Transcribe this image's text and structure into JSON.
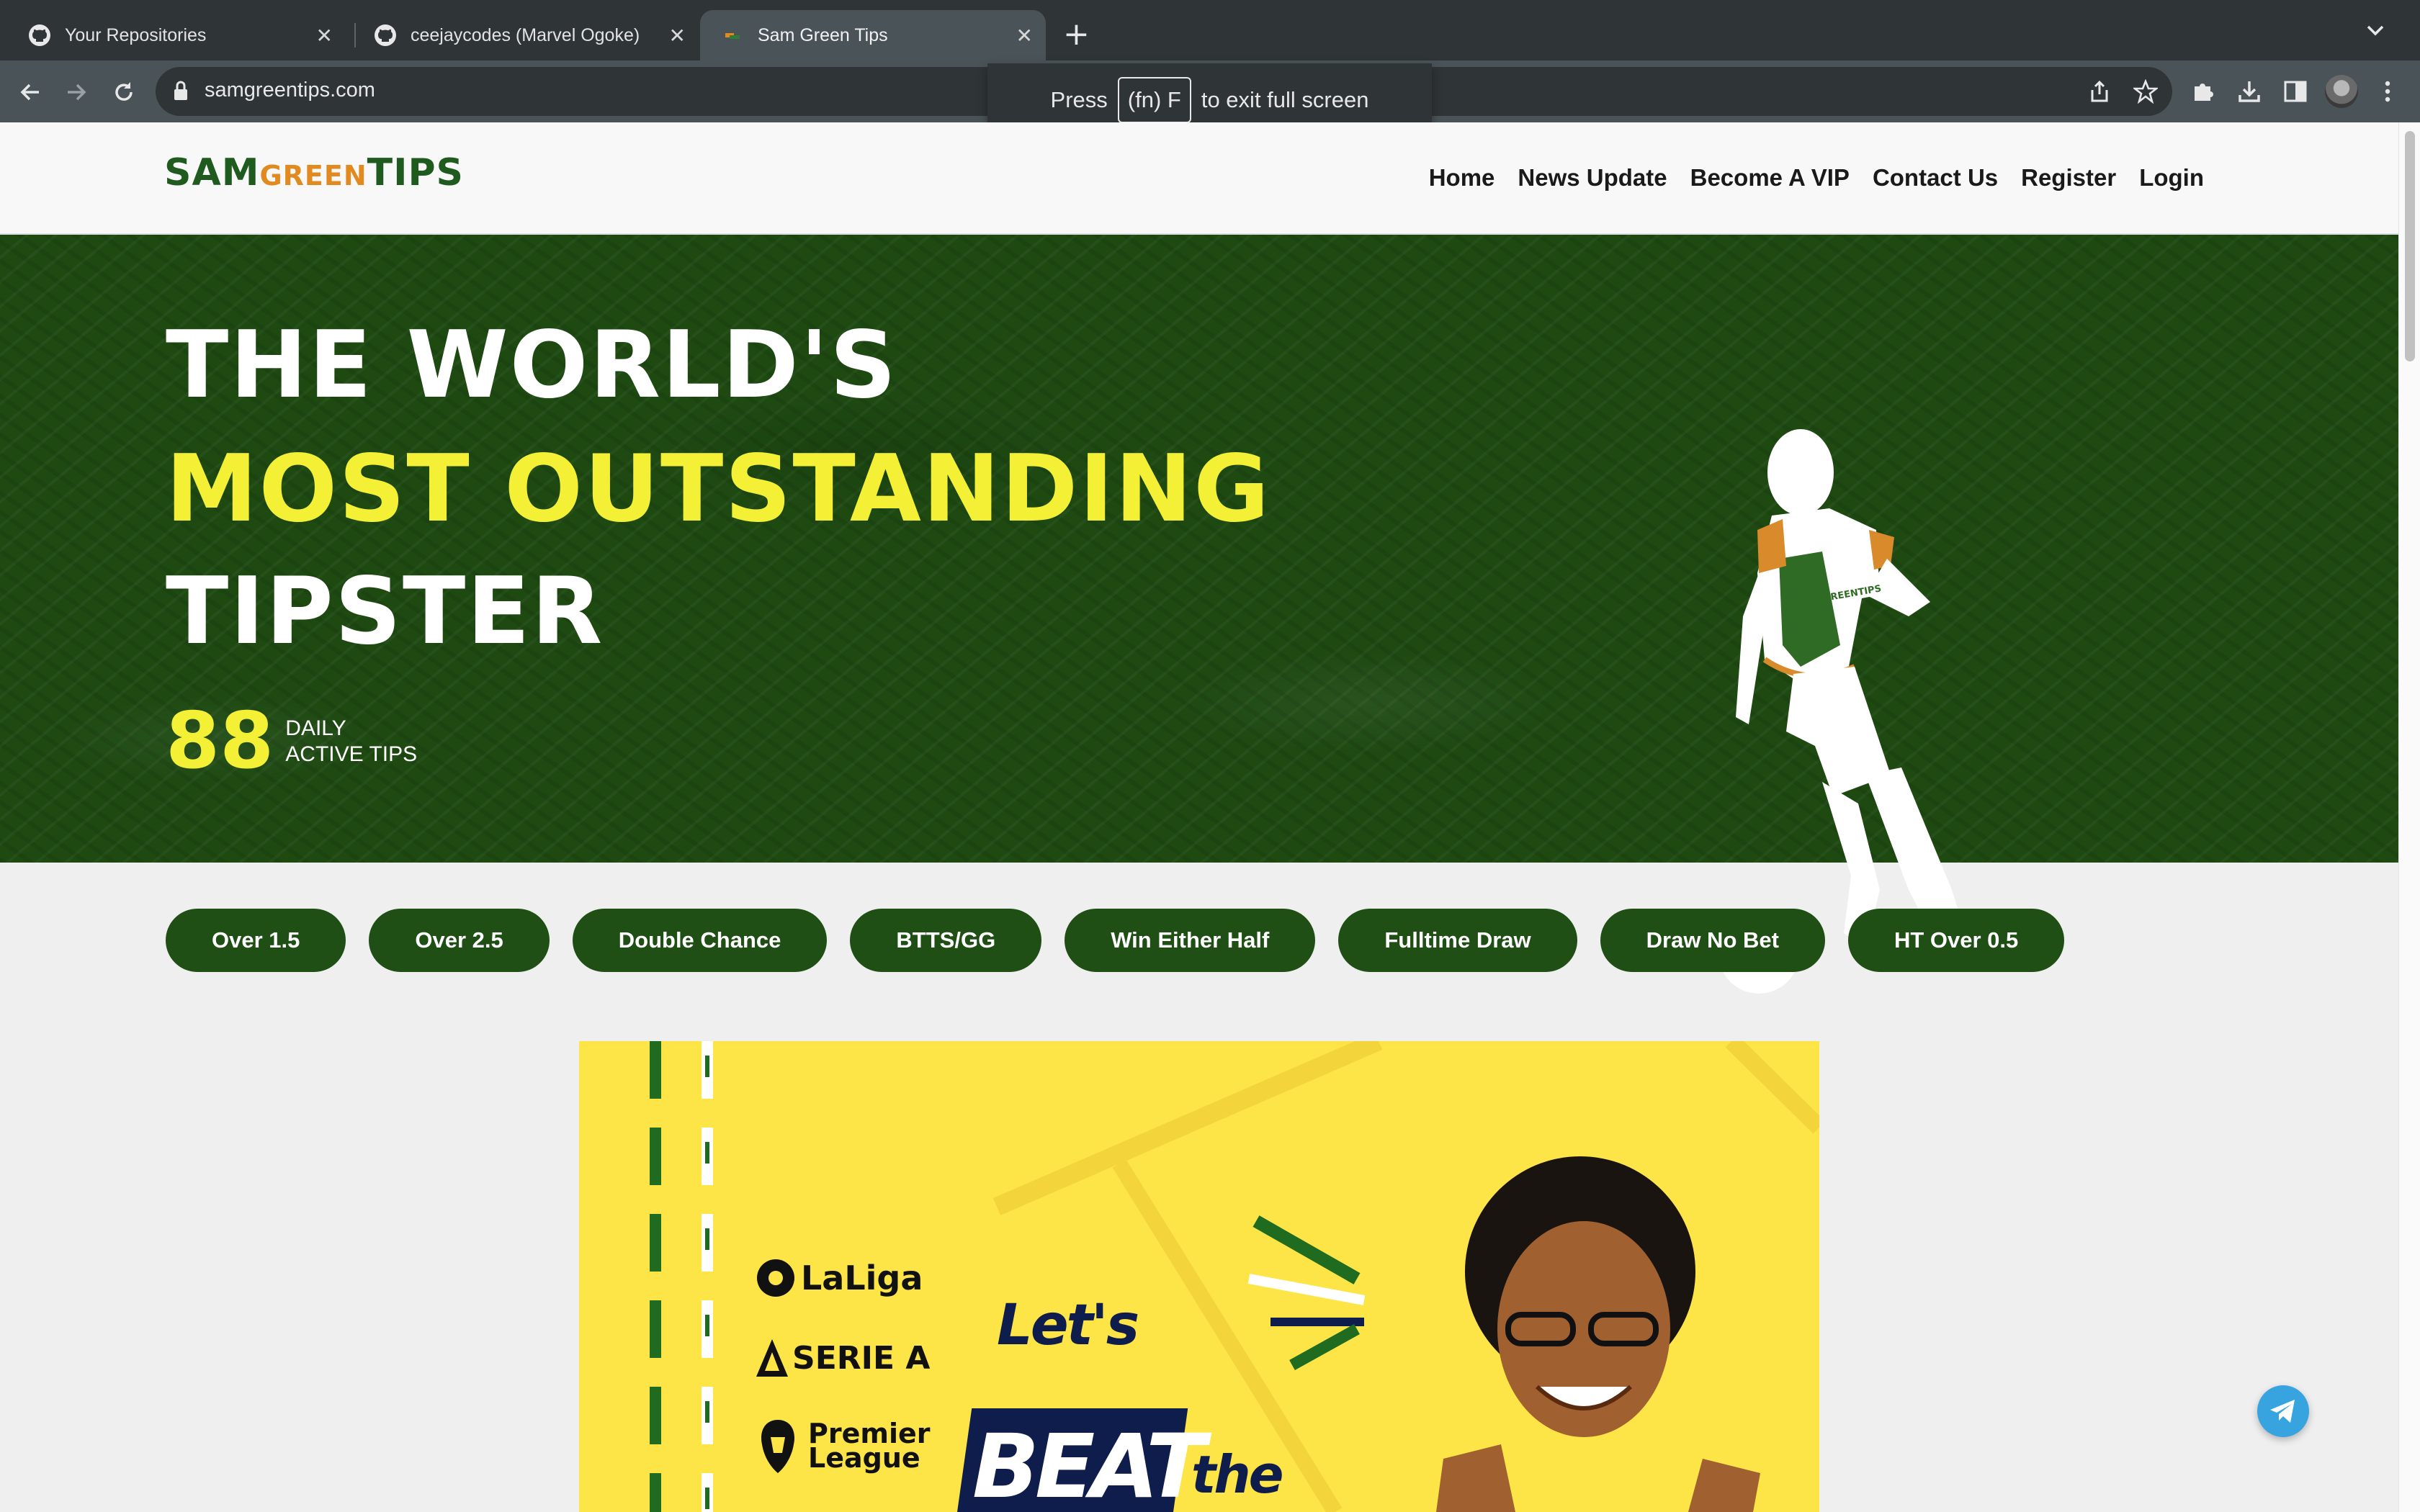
{
  "browser": {
    "tabs": [
      {
        "title": "Your Repositories",
        "icon": "github-icon"
      },
      {
        "title": "ceejaycodes (Marvel Ogoke)",
        "icon": "github-icon"
      },
      {
        "title": "Sam Green Tips",
        "icon": "site-favicon"
      }
    ],
    "url": "samgreentips.com",
    "fullscreen_toast": {
      "prefix": "Press",
      "key": "(fn) F",
      "suffix": "to exit full screen"
    }
  },
  "site": {
    "logo": {
      "part1": "SAM",
      "part2": "GREEN",
      "part3": "TIPS"
    },
    "nav": [
      "Home",
      "News Update",
      "Become A VIP",
      "Contact Us",
      "Register",
      "Login"
    ]
  },
  "hero": {
    "line1": "THE WORLD'S",
    "line2": "MOST OUTSTANDING",
    "line3": "TIPSTER",
    "stat_number": "88",
    "stat_label_1": "DAILY",
    "stat_label_2": "ACTIVE TIPS",
    "jersey_text": "SAMGREENTIPS"
  },
  "categories": [
    "Over 1.5",
    "Over 2.5",
    "Double Chance",
    "BTTS/GG",
    "Win Either Half",
    "Fulltime Draw",
    "Draw No Bet",
    "HT Over 0.5"
  ],
  "banner": {
    "leagues": [
      "LaLiga",
      "SERIE A",
      "Premier",
      "League"
    ],
    "tagline_1": "Let's",
    "tagline_2": "BEAT",
    "tagline_3": "the"
  },
  "colors": {
    "brand_green": "#1f4f15",
    "brand_yellow": "#f4f036",
    "brand_orange": "#e08a1f",
    "banner_yellow": "#fde447",
    "navy": "#0f1d4c"
  }
}
